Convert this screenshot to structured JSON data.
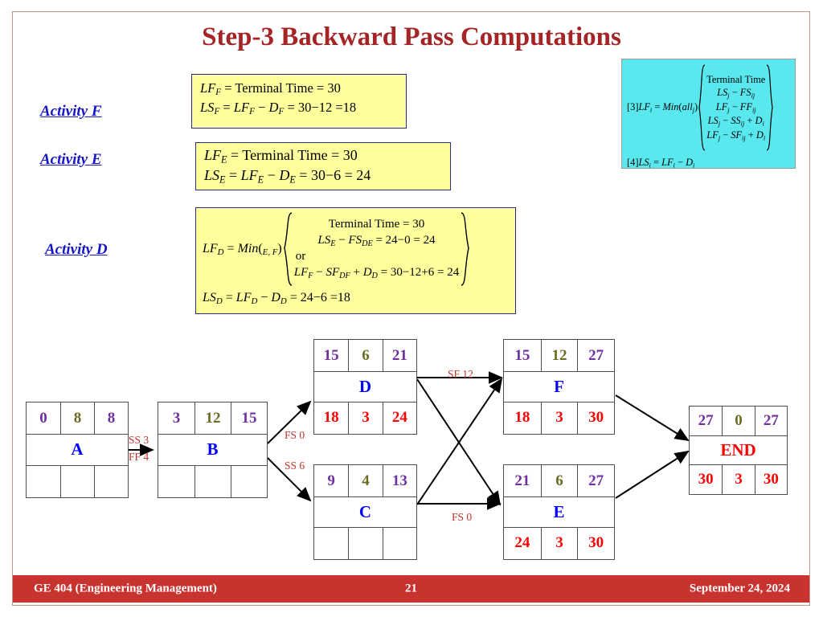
{
  "slide": {
    "title": "Step-3 Backward Pass Computations",
    "accent_red": "#a52426",
    "footer_bar_color": "#c8332f",
    "formula_box_color": "#ffff9e",
    "rule_box_color": "#5ae8ef"
  },
  "activity_labels": {
    "f": "Activity F",
    "e": "Activity E",
    "d": "Activity D"
  },
  "formulas": {
    "f": {
      "line1": {
        "lhs": "LF",
        "sub": "F",
        "text": "= Terminal Time = 30"
      },
      "line2": {
        "lhs": "LS",
        "sub": "F",
        "text": "= LF_F − D_F = 30 − 12 = 18"
      },
      "line2_parts": {
        "a": "LF",
        "asub": "F",
        "b": "D",
        "bsub": "F",
        "result": "= 30 − 12 = 18"
      }
    },
    "e": {
      "line1": {
        "lhs": "LF",
        "sub": "E",
        "text": "= Terminal Time = 30"
      },
      "line2_parts": {
        "a": "LF",
        "asub": "E",
        "b": "D",
        "bsub": "E",
        "result": "= 30 − 6 = 24"
      }
    },
    "d": {
      "lhs": "LF",
      "lhs_sub": "D",
      "min_label": "Min(",
      "min_sub": "E, F",
      "min_close": ")",
      "option1": "Terminal Time = 30",
      "option2_parts": {
        "a": "LS",
        "asub": "E",
        "b": "FS",
        "bsub": "DE",
        "result": "= 24 − 0 = 24"
      },
      "or": "or",
      "option3_parts": {
        "a": "LF",
        "asub": "F",
        "b": "SF",
        "bsub": "DF",
        "c": "D",
        "csub": "D",
        "result": "= 30 − 12 + 6 = 24"
      },
      "last_parts": {
        "lhs": "LS",
        "lhs_sub": "D",
        "a": "LF",
        "asub": "D",
        "b": "D",
        "bsub": "D",
        "result": "= 24 − 6 = 18"
      }
    }
  },
  "rule_box": {
    "tag3": "[3]",
    "lf_lhs": "LF",
    "lf_sub": "i",
    "min_text": "= Min(all",
    "min_sub": "j",
    "min_close": ")",
    "options": [
      "Terminal Time",
      "LS_j − FS_ij",
      "LF_j − FF_ij",
      "LS_j − SS_ij + D_i",
      "LF_j − SF_ij + D_i"
    ],
    "tag4": "[4]",
    "ls_line": "LS_i = LF_i − D_i"
  },
  "network": {
    "nodes": [
      {
        "id": "A",
        "name": "A",
        "top": [
          "0",
          "8",
          "8"
        ],
        "bottom": [
          "",
          "",
          ""
        ]
      },
      {
        "id": "B",
        "name": "B",
        "top": [
          "3",
          "12",
          "15"
        ],
        "bottom": [
          "",
          "",
          ""
        ]
      },
      {
        "id": "D",
        "name": "D",
        "top": [
          "15",
          "6",
          "21"
        ],
        "bottom": [
          "18",
          "3",
          "24"
        ]
      },
      {
        "id": "C",
        "name": "C",
        "top": [
          "9",
          "4",
          "13"
        ],
        "bottom": [
          "",
          "",
          ""
        ]
      },
      {
        "id": "F",
        "name": "F",
        "top": [
          "15",
          "12",
          "27"
        ],
        "bottom": [
          "18",
          "3",
          "30"
        ]
      },
      {
        "id": "E",
        "name": "E",
        "top": [
          "21",
          "6",
          "27"
        ],
        "bottom": [
          "24",
          "3",
          "30"
        ]
      },
      {
        "id": "END",
        "name": "END",
        "top": [
          "27",
          "0",
          "27"
        ],
        "bottom": [
          "30",
          "3",
          "30"
        ]
      }
    ],
    "edge_labels": {
      "ab_ss": "SS 3",
      "ab_ff": "FF 4",
      "bd_fs": "FS 0",
      "bc_ss": "SS 6",
      "df_sf": "SF 12",
      "ce_fs": "FS 0"
    }
  },
  "footer": {
    "course": "GE 404 (Engineering Management)",
    "page": "21",
    "date": "September 24, 2024"
  }
}
